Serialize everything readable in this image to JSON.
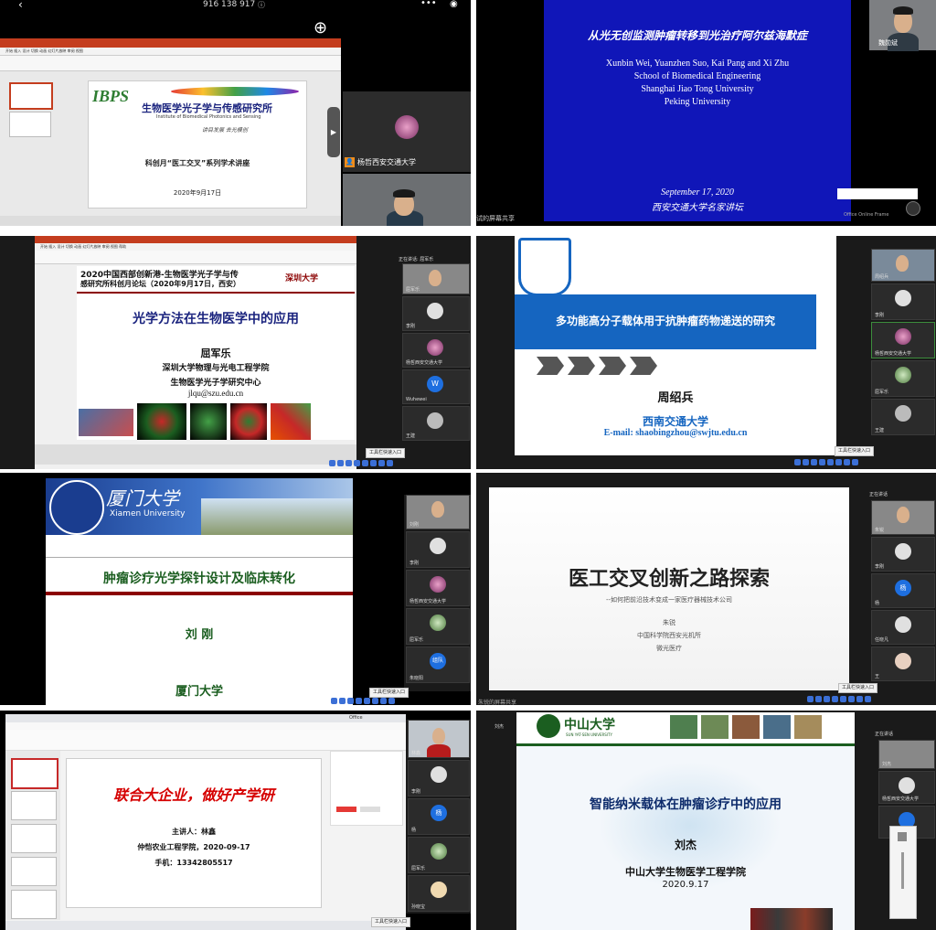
{
  "p1": {
    "status_bar": "916 138 917",
    "logo_abbr": "IBPS",
    "logo_title": "生物医学光子学与传感研究所",
    "logo_subtitle": "Institute of Biomedical Photonics and Sensing",
    "motto": "讲目发展  去光模创",
    "slide_title": "科创月“医工交叉”系列学术讲座",
    "slide_date": "2020年9月17日",
    "participant": "杨哲西安交通大学"
  },
  "p2": {
    "title": "从光无创监测肿瘤转移到光治疗阿尔兹海默症",
    "authors": "Xunbin Wei, Yuanzhen Suo, Kai Pang and Xi Zhu",
    "affil1": "School of Biomedical Engineering",
    "affil2": "Shanghai Jiao Tong University",
    "affil3": "Peking University",
    "date": "September 17, 2020",
    "event": "西安交通大学名家讲坛",
    "speaker": "魏勋斌",
    "left_caption": "试的屏幕共享",
    "frame_label": "Office Online Frame"
  },
  "p3": {
    "header1": "2020中国西部创新港-生物医学光子学与传",
    "header2": "感研究所科创月论坛（2020年9月17日，西安）",
    "univ_logo": "深圳大学",
    "title": "光学方法在生物医学中的应用",
    "speaker": "屈军乐",
    "affil1": "深圳大学物理与光电工程学院",
    "affil2": "生物医学光子学研究中心",
    "email": "jlqu@szu.edu.cn",
    "speaking": "正在讲话: 屈军乐",
    "tile_labels": [
      "屈军乐",
      "李刚",
      "杨哲西安交通大学",
      "Wuhewei",
      "王建"
    ],
    "w_letter": "W",
    "entry": "工具栏快速入口"
  },
  "p4": {
    "title": "多功能高分子载体用于抗肿瘤药物递送的研究",
    "speaker": "周绍兵",
    "univ": "西南交通大学",
    "email": "E-mail: shaobingzhou@swjtu.edu.cn",
    "tile_labels": [
      "周绍兵",
      "李刚",
      "杨哲西安交通大学",
      "屈军乐",
      "王建"
    ],
    "entry": "工具栏快速入口"
  },
  "p5": {
    "logo_cn": "厦门大学",
    "logo_en": "Xiamen University",
    "title": "肿瘤诊疗光学探针设计及临床转化",
    "speaker": "刘 刚",
    "univ": "厦门大学",
    "tile_labels": [
      "刘刚",
      "李刚",
      "杨哲西安交通大学",
      "屈军乐",
      "朱晓阳"
    ],
    "avatar_text": "组队",
    "entry": "工具栏快速入口"
  },
  "p6": {
    "title": "医工交叉创新之路探索",
    "subtitle": "--如何把前沿技术变成一家医疗器械技术公司",
    "speaker": "朱锐",
    "affil": "中国科学院西安光机所",
    "company": "微光医疗",
    "speaking": "正在讲话",
    "tile_labels": [
      "朱锐",
      "李刚",
      "杨",
      "任晓凡",
      "王"
    ],
    "avatar_text": "杨",
    "entry": "工具栏快速入口",
    "bottom_caption": "朱锐的屏幕共享"
  },
  "p7": {
    "slide_title": "联合大企业，做好产学研",
    "presenter": "主讲人：林鑫",
    "affil": "仲恺农业工程学院，2020-09-17",
    "phone": "手机：13342805517",
    "tile_labels": [
      "林鑫",
      "李刚",
      "杨",
      "屈军乐",
      "孙晓宝"
    ],
    "avatar_text": "杨",
    "entry": "工具栏快速入口",
    "office_label": "Office"
  },
  "p8": {
    "logo_cn": "中山大学",
    "logo_en": "SUN YAT-SEN UNIVERSITY",
    "title": "智能纳米载体在肿瘤诊疗中的应用",
    "speaker": "刘杰",
    "affil": "中山大学生物医学工程学院",
    "date": "2020.9.17",
    "speaking": "正在讲话",
    "tile_labels": [
      "刘杰",
      "杨哲西安交通大学"
    ],
    "top_label": "刘杰"
  }
}
